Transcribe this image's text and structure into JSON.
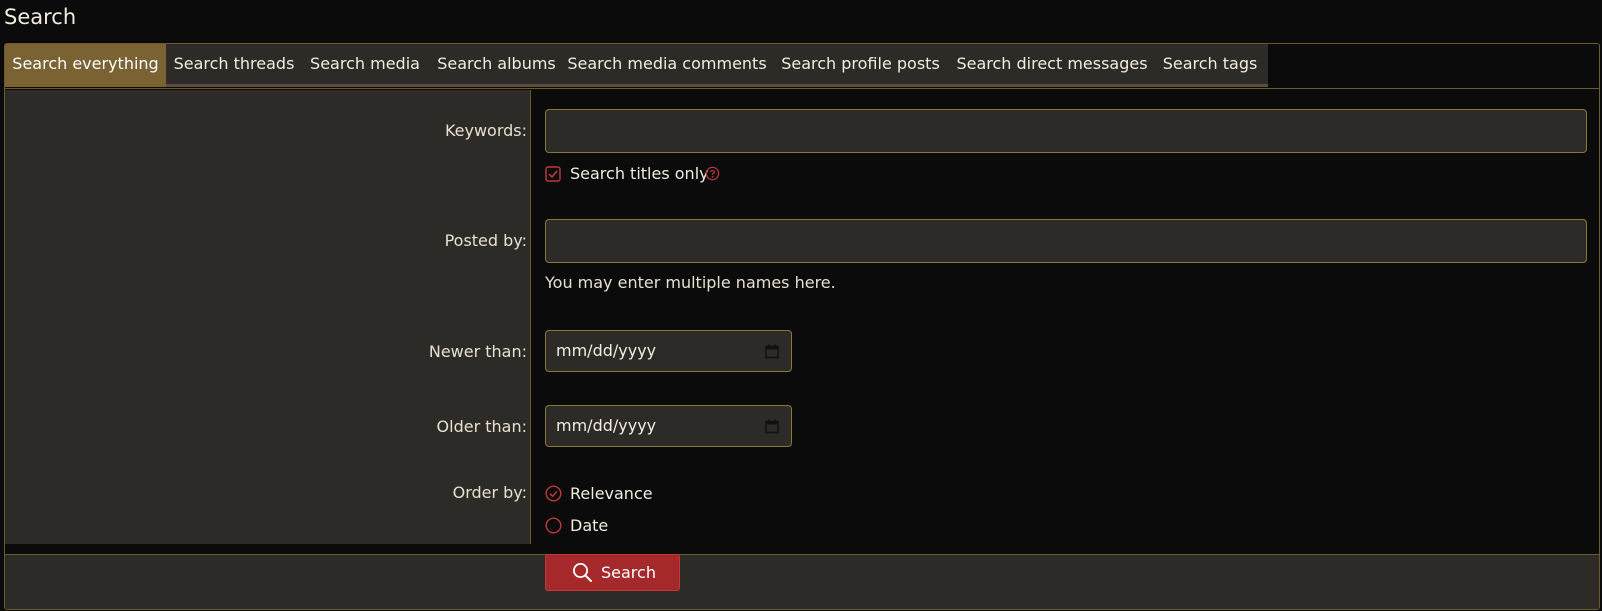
{
  "page": {
    "title": "Search"
  },
  "tabs": [
    {
      "label": "Search everything",
      "active": true
    },
    {
      "label": "Search threads"
    },
    {
      "label": "Search media"
    },
    {
      "label": "Search albums"
    },
    {
      "label": "Search media comments"
    },
    {
      "label": "Search profile posts"
    },
    {
      "label": "Search direct messages"
    },
    {
      "label": "Search tags"
    }
  ],
  "form": {
    "keywords": {
      "label": "Keywords:",
      "value": "",
      "placeholder": ""
    },
    "titles_only": {
      "label": "Search titles only",
      "checked": true,
      "help_icon": "question-circle-icon"
    },
    "posted_by": {
      "label": "Posted by:",
      "value": "",
      "placeholder": "",
      "hint": "You may enter multiple names here."
    },
    "newer_than": {
      "label": "Newer than:",
      "value": "mm/dd/yyyy",
      "icon": "calendar-icon"
    },
    "older_than": {
      "label": "Older than:",
      "value": "mm/dd/yyyy",
      "icon": "calendar-icon"
    },
    "order_by": {
      "label": "Order by:",
      "options": [
        {
          "label": "Relevance",
          "selected": true
        },
        {
          "label": "Date",
          "selected": false
        }
      ]
    }
  },
  "actions": {
    "search_label": "Search",
    "search_icon": "search-icon"
  },
  "colors": {
    "accent": "#7a6232",
    "border": "#6b5a2e",
    "panel": "#2d2b27",
    "background": "#0b0b0b",
    "button": "#a5292b",
    "check": "#c0393b"
  }
}
